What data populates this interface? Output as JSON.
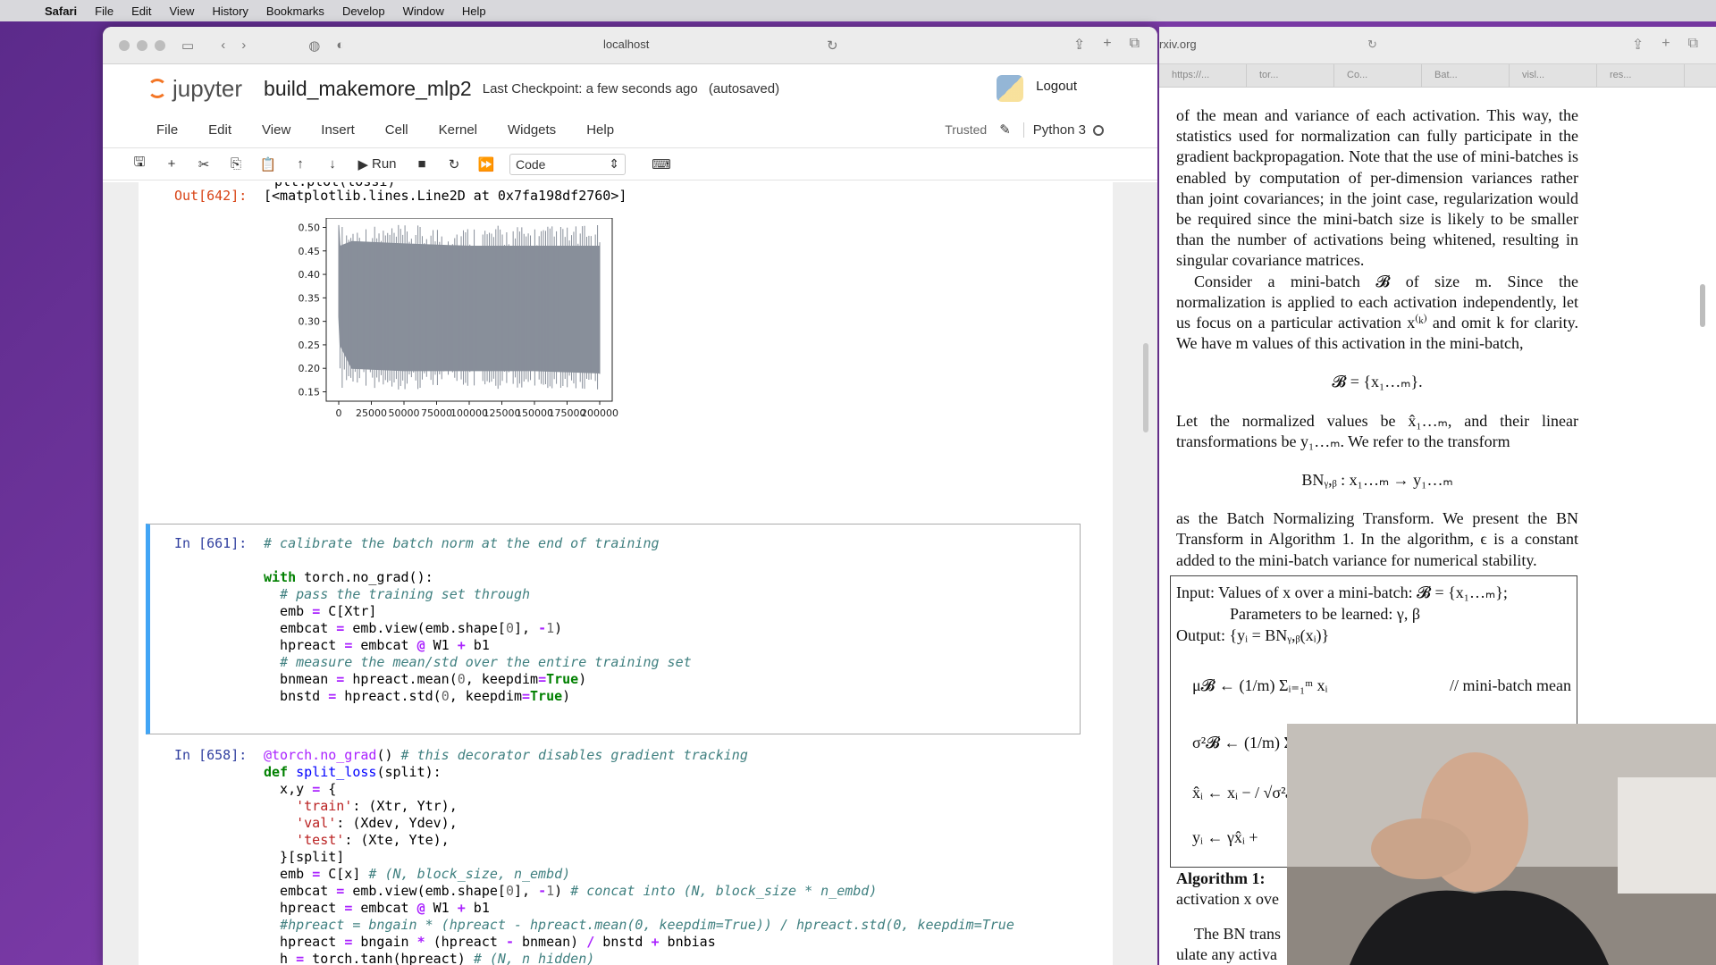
{
  "menubar": {
    "app": "Safari",
    "items": [
      "File",
      "Edit",
      "View",
      "History",
      "Bookmarks",
      "Develop",
      "Window",
      "Help"
    ]
  },
  "safari": {
    "url": "localhost"
  },
  "jupyter": {
    "wordmark": "jupyter",
    "notebook_name": "build_makemore_mlp2",
    "checkpoint": "Last Checkpoint: a few seconds ago",
    "autosaved": "(autosaved)",
    "logout": "Logout",
    "menu": [
      "File",
      "Edit",
      "View",
      "Insert",
      "Cell",
      "Kernel",
      "Widgets",
      "Help"
    ],
    "trusted": "Trusted",
    "kernel": "Python 3",
    "toolbar": {
      "run_label": "Run",
      "cell_type": "Code"
    }
  },
  "notebook": {
    "out_prompt": "Out[642]:",
    "out_text": "[<matplotlib.lines.Line2D at 0x7fa198df2760>]",
    "cell1_prompt": "In [661]:",
    "cell2_prompt": "In [658]:"
  },
  "chart_data": {
    "type": "line",
    "series_color": "#888f9a",
    "xlim": [
      0,
      200000
    ],
    "ylim": [
      0.13,
      0.52
    ],
    "xticks": [
      "0",
      "25000",
      "50000",
      "75000",
      "100000",
      "125000",
      "150000",
      "175000",
      "200000"
    ],
    "yticks": [
      "0.50",
      "0.45",
      "0.40",
      "0.35",
      "0.30",
      "0.25",
      "0.20",
      "0.15"
    ],
    "band_upper": [
      [
        0,
        0.505
      ],
      [
        1000,
        0.46
      ],
      [
        10000,
        0.47
      ],
      [
        50000,
        0.465
      ],
      [
        100000,
        0.46
      ],
      [
        150000,
        0.46
      ],
      [
        200000,
        0.46
      ]
    ],
    "band_lower": [
      [
        0,
        0.31
      ],
      [
        1000,
        0.25
      ],
      [
        10000,
        0.2
      ],
      [
        50000,
        0.195
      ],
      [
        100000,
        0.195
      ],
      [
        150000,
        0.195
      ],
      [
        200000,
        0.19
      ]
    ]
  },
  "right_window": {
    "url": "rxiv.org",
    "tabs": [
      "https://...",
      "tor...",
      "Co...",
      "Bat...",
      "visl...",
      "res..."
    ]
  },
  "paper": {
    "p1": "of the mean and variance of each activation. This way, the statistics used for normalization can fully participate in the gradient backpropagation. Note that the use of mini-batches is enabled by computation of per-dimension variances rather than joint covariances; in the joint case, regularization would be required since the mini-batch size is likely to be smaller than the number of activations being whitened, resulting in singular covariance matrices.",
    "p2": "Consider a mini-batch 𝓑 of size m. Since the normalization is applied to each activation independently, let us focus on a particular activation x⁽ᵏ⁾ and omit k for clarity. We have m values of this activation in the mini-batch,",
    "eq1": "𝓑 = {x₁…ₘ}.",
    "p3": "Let the normalized values be x̂₁…ₘ, and their linear transformations be y₁…ₘ. We refer to the transform",
    "eq2": "BNᵧ,ᵦ : x₁…ₘ → y₁…ₘ",
    "p4": "as the Batch Normalizing Transform. We present the BN Transform in Algorithm 1. In the algorithm, ϵ is a constant added to the mini-batch variance for numerical stability.",
    "algo_input": "Input: Values of x over a mini-batch: 𝓑 = {x₁…ₘ};",
    "algo_params": "Parameters to be learned: γ, β",
    "algo_output": "Output: {yᵢ = BNᵧ,ᵦ(xᵢ)}",
    "algo_mean": "μ𝓑 ← (1/m) Σᵢ₌₁ᵐ xᵢ",
    "algo_mean_comment": "// mini-batch mean",
    "algo_var": "σ²𝓑 ← (1/m) Σ",
    "algo_norm": "x̂ᵢ ← xᵢ − / √σ²𝓑",
    "algo_scale": "yᵢ ← γx̂ᵢ +",
    "algo_caption_a": "Algorithm 1:",
    "algo_caption_b": "activation x ove",
    "p5": "The BN trans",
    "p5b": "ulate any activa"
  }
}
